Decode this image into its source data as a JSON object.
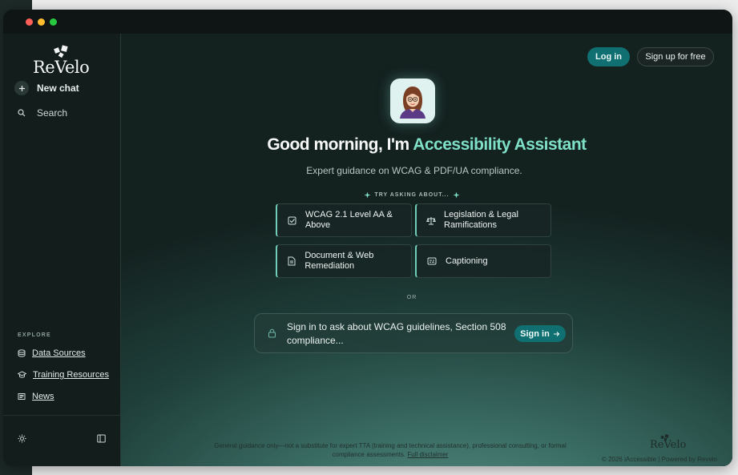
{
  "brand": {
    "logo_text": "ReVelo"
  },
  "sidebar": {
    "new_chat": "New chat",
    "search": "Search",
    "explore_label": "EXPLORE",
    "explore_links": [
      "Data Sources",
      "Training Resources",
      "News"
    ]
  },
  "header": {
    "login": "Log in",
    "signup": "Sign up for free"
  },
  "hero": {
    "greeting_prefix": "Good morning, I'm ",
    "assistant_name": "Accessibility Assistant",
    "subtitle": "Expert guidance on WCAG & PDF/UA compliance.",
    "try_label": "TRY ASKING ABOUT..."
  },
  "suggestions": [
    {
      "label": "WCAG 2.1 Level AA & Above",
      "icon": "checkbox-icon"
    },
    {
      "label": "Legislation & Legal Ramifications",
      "icon": "scales-icon"
    },
    {
      "label": "Document & Web Remediation",
      "icon": "document-icon"
    },
    {
      "label": "Captioning",
      "icon": "caption-icon"
    }
  ],
  "divider_text": "OR",
  "signin_box": {
    "prompt": "Sign in to ask about WCAG guidelines, Section 508 compliance...",
    "button": "Sign in"
  },
  "footer": {
    "disclaimer": "General guidance only—not a substitute for expert TTA (training and technical assistance), professional consulting, or formal compliance assessments.",
    "disclaimer_link": "Full disclaimer",
    "logo_text": "ReVelo",
    "copyright": "© 2026 iAccessible | Powered by Revelo"
  },
  "colors": {
    "accent": "#7fe0c8",
    "primary_button": "#0f6f71"
  }
}
